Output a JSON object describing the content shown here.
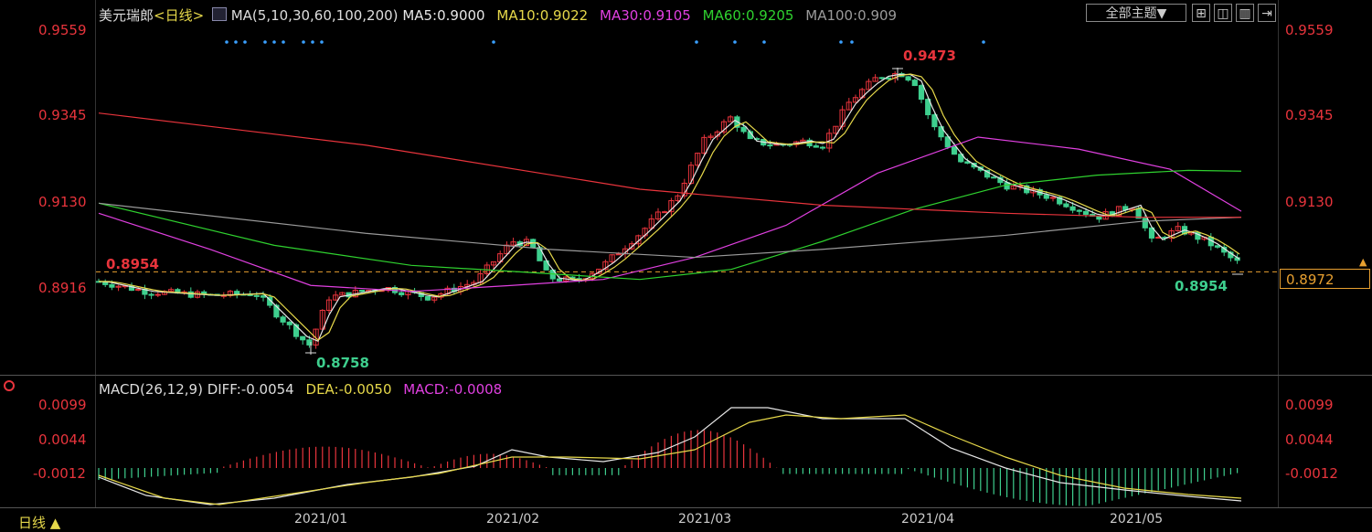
{
  "header": {
    "symbol": "美元瑞郎",
    "period": "<日线>",
    "ma_params": "MA(5,10,30,60,100,200)",
    "ma5": "MA5:0.9000",
    "ma10": "MA10:0.9022",
    "ma30": "MA30:0.9105",
    "ma60": "MA60:0.9205",
    "ma100": "MA100:0.909",
    "theme_button": "全部主题▼"
  },
  "price_axis": {
    "ticks": [
      "0.9559",
      "0.9345",
      "0.9130",
      "0.8916"
    ],
    "current_price": "0.8972",
    "current_marker": "0.8954"
  },
  "annotations": {
    "high": "0.9473",
    "low": "0.8758",
    "recent_low": "0.8954",
    "dashed_level": "0.8954"
  },
  "macd": {
    "title": "MACD(26,12,9)",
    "diff": "DIFF:-0.0054",
    "dea": "DEA:-0.0050",
    "macd": "MACD:-0.0008",
    "ticks": [
      "0.0099",
      "0.0044",
      "-0.0012"
    ]
  },
  "dates": [
    "2021/01",
    "2021/02",
    "2021/03",
    "2021/04",
    "2021/05"
  ],
  "footer": {
    "period_label": "日线 ▲"
  },
  "colors": {
    "up": "#e8343c",
    "down": "#3ecf8e",
    "ma5": "#e6e6e6",
    "ma10": "#e6d84a",
    "ma30": "#e040e0",
    "ma60": "#2fd12f",
    "ma100": "#9a9a9a",
    "ma200": "#e8343c"
  }
}
